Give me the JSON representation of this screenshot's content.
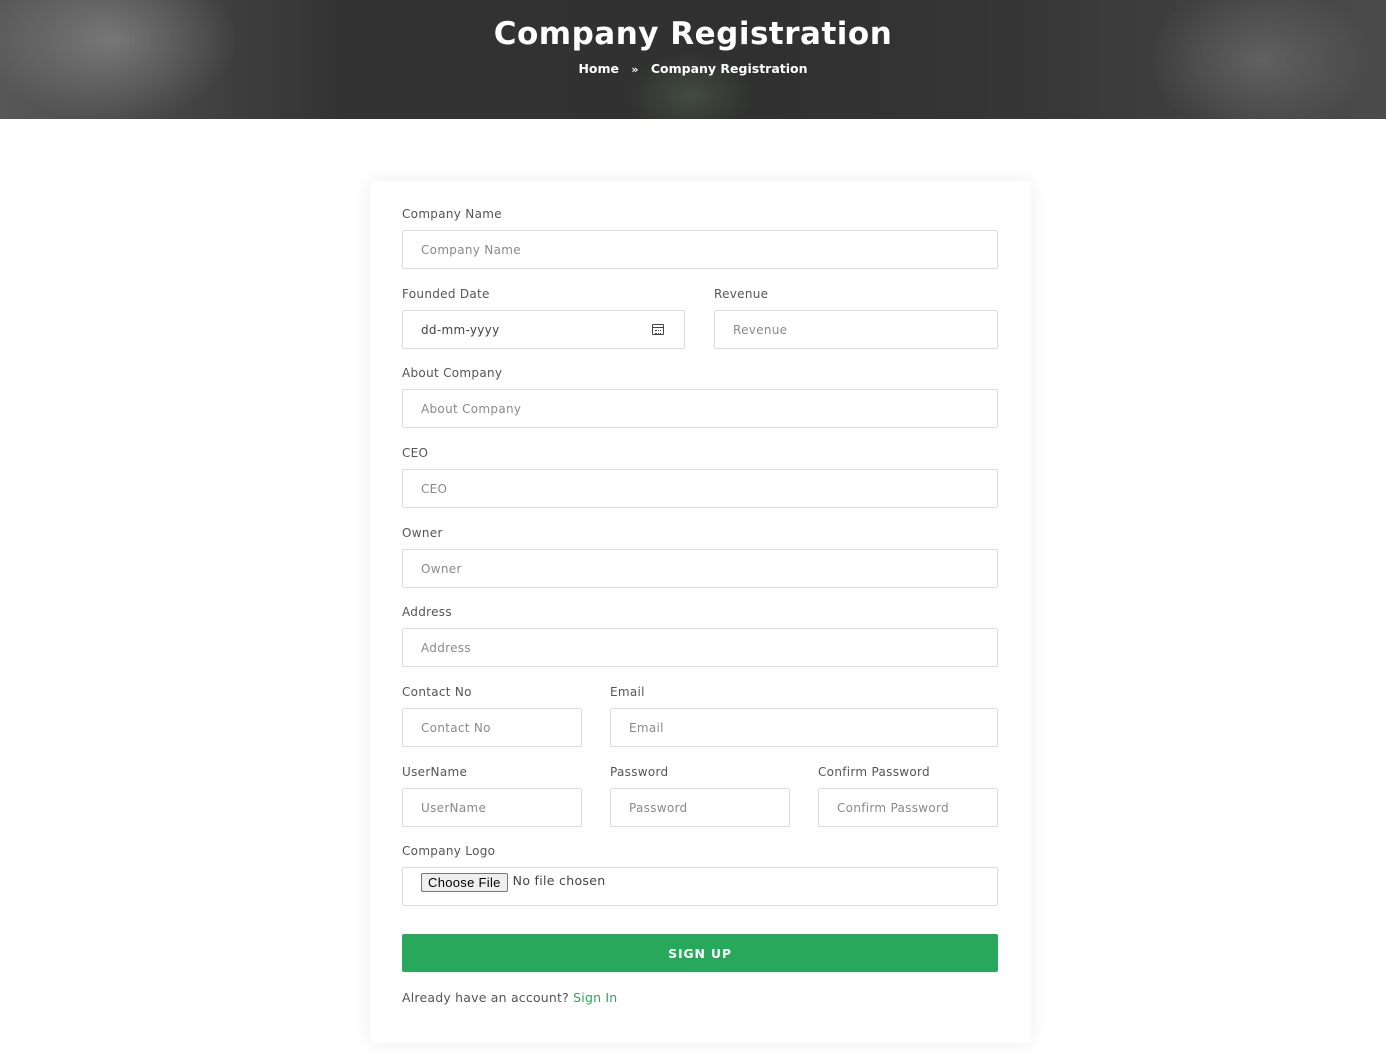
{
  "header": {
    "title": "Company Registration",
    "breadcrumb": {
      "home": "Home",
      "separator": "»",
      "current": "Company Registration"
    }
  },
  "form": {
    "company_name": {
      "label": "Company Name",
      "placeholder": "Company Name"
    },
    "founded_date": {
      "label": "Founded Date",
      "placeholder": "dd-mm-yyyy"
    },
    "revenue": {
      "label": "Revenue",
      "placeholder": "Revenue"
    },
    "about": {
      "label": "About Company",
      "placeholder": "About Company"
    },
    "ceo": {
      "label": "CEO",
      "placeholder": "CEO"
    },
    "owner": {
      "label": "Owner",
      "placeholder": "Owner"
    },
    "address": {
      "label": "Address",
      "placeholder": "Address"
    },
    "contact": {
      "label": "Contact No",
      "placeholder": "Contact No"
    },
    "email": {
      "label": "Email",
      "placeholder": "Email"
    },
    "username": {
      "label": "UserName",
      "placeholder": "UserName"
    },
    "password": {
      "label": "Password",
      "placeholder": "Password"
    },
    "confirm_password": {
      "label": "Confirm Password",
      "placeholder": "Confirm Password"
    },
    "logo": {
      "label": "Company Logo",
      "button": "Choose File",
      "status": "No file chosen"
    },
    "submit": "SIGN UP",
    "footer": {
      "text": "Already have an account?",
      "link": "Sign In"
    }
  },
  "colors": {
    "accent": "#28a85a"
  }
}
